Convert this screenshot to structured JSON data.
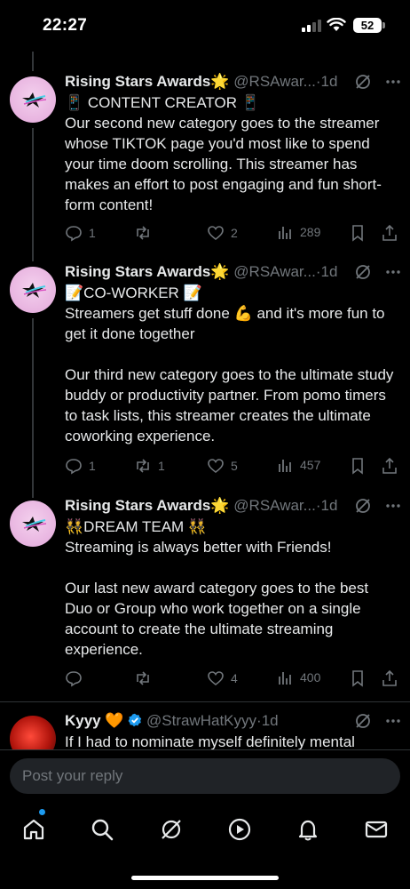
{
  "status_bar": {
    "time": "22:27",
    "battery": "52"
  },
  "tweets": [
    {
      "display_name": "Rising Stars Awards🌟",
      "handle": "@RSAwar...",
      "dot": "·",
      "age": "1d",
      "body": "📱 CONTENT CREATOR 📱\nOur second new category goes to the streamer whose TIKTOK page you'd most like to spend your time doom scrolling. This streamer has makes an effort to post engaging and fun short-form content!",
      "replies": "1",
      "reposts": "",
      "likes": "2",
      "views": "289"
    },
    {
      "display_name": "Rising Stars Awards🌟",
      "handle": "@RSAwar...",
      "dot": "·",
      "age": "1d",
      "body": "📝CO-WORKER 📝\nStreamers get stuff done 💪 and it's more fun to get it done together\n\nOur third new category goes to the ultimate study buddy or productivity partner. From pomo timers to task lists, this streamer creates the ultimate coworking experience.",
      "replies": "1",
      "reposts": "1",
      "likes": "5",
      "views": "457"
    },
    {
      "display_name": "Rising Stars Awards🌟",
      "handle": "@RSAwar...",
      "dot": "·",
      "age": "1d",
      "body": "👯DREAM TEAM 👯\nStreaming is always better with Friends!\n\nOur last new award category goes to the best Duo or Group who work together on a single account to create the ultimate streaming experience.",
      "replies": "",
      "reposts": "",
      "likes": "4",
      "views": "400"
    },
    {
      "display_name": "Kyyy 🧡",
      "handle": "@StrawHatKyyy",
      "dot": "·",
      "age": "1d",
      "body": "If I had to nominate myself definitely mental"
    }
  ],
  "reply_bar": {
    "placeholder": "Post your reply"
  },
  "tab_bar": {
    "items": [
      "home-icon",
      "search-icon",
      "grok-icon",
      "video-icon",
      "notifications-icon",
      "messages-icon"
    ],
    "active": "home-icon"
  },
  "colors": {
    "background": "#000000",
    "text": "#e7e9ea",
    "muted": "#71767b",
    "accent": "#1d9bf0",
    "verified": "#1d9bf0"
  }
}
